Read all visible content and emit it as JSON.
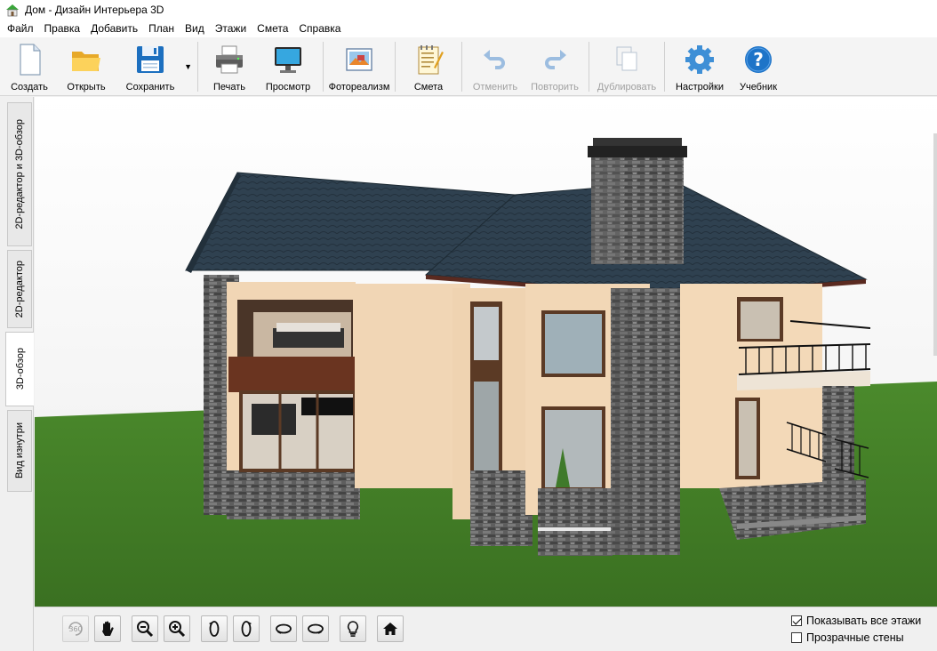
{
  "window": {
    "title": "Дом - Дизайн Интерьера 3D"
  },
  "menu": [
    "Файл",
    "Правка",
    "Добавить",
    "План",
    "Вид",
    "Этажи",
    "Смета",
    "Справка"
  ],
  "toolbar": {
    "create": "Создать",
    "open": "Открыть",
    "save": "Сохранить",
    "print": "Печать",
    "preview": "Просмотр",
    "photorealism": "Фотореализм",
    "estimate": "Смета",
    "undo": "Отменить",
    "redo": "Повторить",
    "duplicate": "Дублировать",
    "settings": "Настройки",
    "tutorial": "Учебник"
  },
  "tabs": {
    "editor_2d_3d": "2D-редактор и 3D-обзор",
    "editor_2d": "2D-редактор",
    "view_3d": "3D-обзор",
    "inside_view": "Вид изнутри",
    "active": "3D-обзор"
  },
  "view_controls": {
    "rotate360": "360",
    "icons": [
      "360-icon",
      "hand-icon",
      "zoom-out-icon",
      "zoom-in-icon",
      "rotate-left-icon",
      "rotate-right-icon",
      "orbit-left-icon",
      "orbit-right-icon",
      "light-bulb-icon",
      "home-icon"
    ]
  },
  "options": {
    "show_all_floors": {
      "label": "Показывать все этажи",
      "checked": true
    },
    "transparent_walls": {
      "label": "Прозрачные стены",
      "checked": false
    }
  },
  "colors": {
    "accent": "#1e74c8",
    "roof": "#2e3f4c",
    "wall": "#f0d4b3",
    "stone": "#5a5a5a",
    "grass": "#3f7a26"
  }
}
